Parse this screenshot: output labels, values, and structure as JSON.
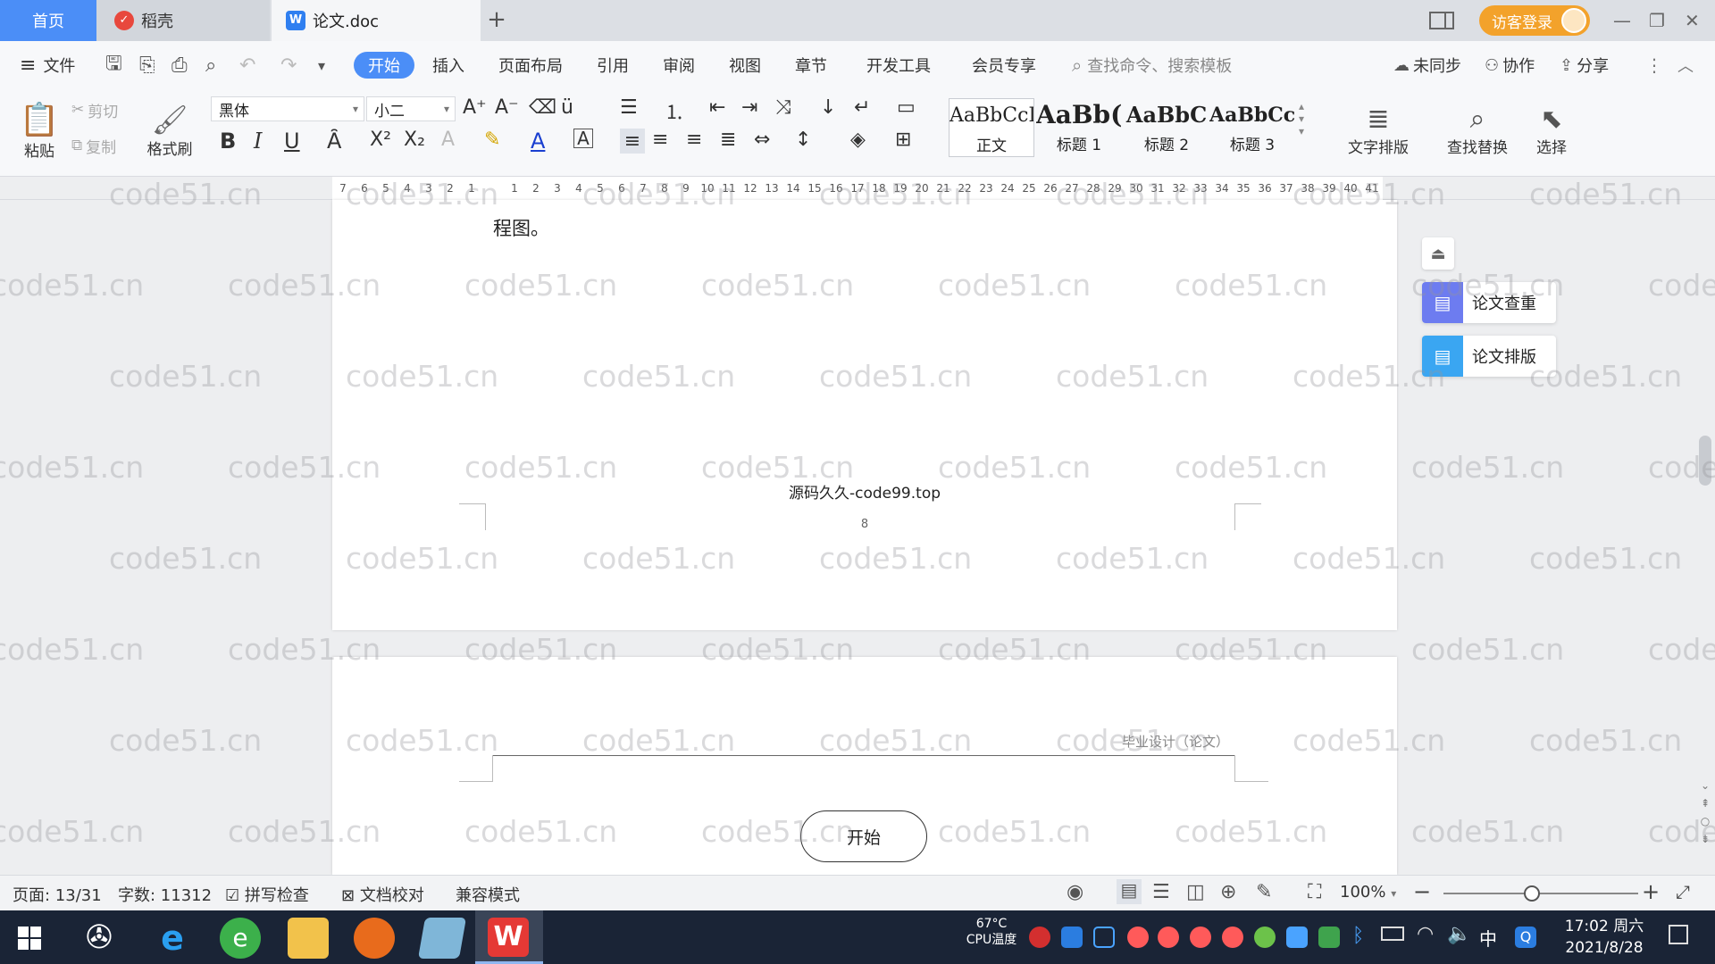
{
  "tabs": {
    "home": "首页",
    "daoke": "稻壳",
    "doc": "论文.doc",
    "add": "+"
  },
  "titlebar": {
    "login": "访客登录"
  },
  "menu": {
    "file": "文件",
    "items": [
      "开始",
      "插入",
      "页面布局",
      "引用",
      "审阅",
      "视图",
      "章节",
      "开发工具",
      "会员专享"
    ],
    "search_placeholder": "查找命令、搜索模板",
    "sync": "未同步",
    "collab": "协作",
    "share": "分享"
  },
  "toolbar": {
    "paste": "粘贴",
    "cut": "剪切",
    "copy": "复制",
    "format_painter": "格式刷",
    "font_name": "黑体",
    "font_size": "小二",
    "styles": [
      {
        "preview": "AaBbCcI",
        "label": "正文"
      },
      {
        "preview": "AaBb(",
        "label": "标题 1"
      },
      {
        "preview": "AaBbC",
        "label": "标题 2"
      },
      {
        "preview": "AaBbCcl",
        "label": "标题 3"
      }
    ],
    "text_layout": "文字排版",
    "find_replace": "查找替换",
    "select": "选择"
  },
  "ruler": {
    "left_ticks": [
      "7",
      "6",
      "5",
      "4",
      "3",
      "2",
      "1"
    ],
    "right_ticks": [
      "1",
      "2",
      "3",
      "4",
      "5",
      "6",
      "7",
      "8",
      "9",
      "10",
      "11",
      "12",
      "13",
      "14",
      "15",
      "16",
      "17",
      "18",
      "19",
      "20",
      "21",
      "22",
      "23",
      "24",
      "25",
      "26",
      "27",
      "28",
      "29",
      "30",
      "31",
      "32",
      "33",
      "34",
      "35",
      "36",
      "37",
      "38",
      "39",
      "40",
      "41"
    ]
  },
  "document": {
    "page1_text": "程图。",
    "footer_text": "源码久久-code99.top",
    "page_number": "8",
    "page2_header": "毕业设计（论文）",
    "flow_start": "开始"
  },
  "side_panel": {
    "check": "论文查重",
    "layout": "论文排版"
  },
  "watermark": "code51.cn",
  "statusbar": {
    "page": "页面: 13/31",
    "words": "字数: 11312",
    "spell": "拼写检查",
    "proof": "文档校对",
    "compat": "兼容模式",
    "zoom": "100%"
  },
  "taskbar": {
    "temp": "67°C",
    "cpu": "CPU温度",
    "ime": "中",
    "time": "17:02 周六",
    "date": "2021/8/28"
  }
}
